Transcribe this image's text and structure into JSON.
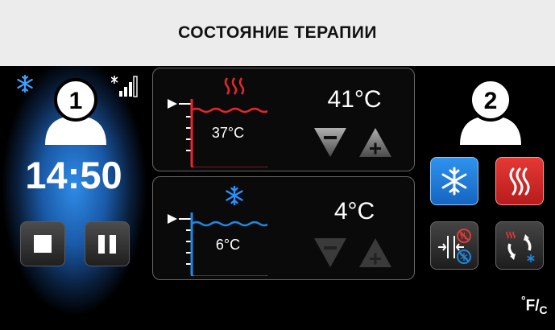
{
  "header": {
    "title": "СОСТОЯНИЕ ТЕРАПИИ"
  },
  "patient1": {
    "number": "1",
    "time": "14:50",
    "mode_icon": "snowflake-icon",
    "signal_icon": "signal-strength-icon",
    "stop_icon": "stop-icon",
    "pause_icon": "pause-icon"
  },
  "hot_reservoir": {
    "water_temp": "37°C",
    "setpoint": "41°C",
    "icon": "heat-waves-icon",
    "color": "#e8262b",
    "decrease_icon": "triangle-minus-icon",
    "increase_icon": "triangle-plus-icon"
  },
  "cold_reservoir": {
    "water_temp": "6°C",
    "setpoint": "4°C",
    "icon": "snowflake-icon",
    "color": "#1e88e5",
    "controls_enabled": false
  },
  "patient2": {
    "number": "2",
    "cool_icon": "snowflake-icon",
    "heat_icon": "heat-waves-icon",
    "toggle_icon": "heat-cool-toggle-icon",
    "cycle_icon": "cycle-heat-cool-icon"
  },
  "units": {
    "deg": "°",
    "f": "F",
    "c": "C"
  },
  "colors": {
    "cool_blue": "#1e88e5",
    "heat_red": "#e53935",
    "header_bg": "#ececec"
  }
}
